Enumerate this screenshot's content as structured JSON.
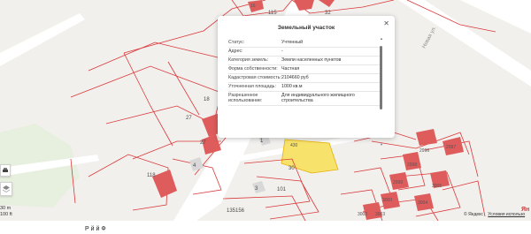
{
  "map": {
    "parcel_labels": [
      "115",
      "16",
      "32",
      "18",
      "27",
      "27",
      "4",
      "118",
      "3",
      "30",
      "101",
      "1",
      "135156",
      "430",
      "2996",
      "2997",
      "2998",
      "3005",
      "2999",
      "3004",
      "3000",
      "3003",
      "3002"
    ],
    "street_label": "Новая ул.",
    "highlight_color": "#f7e26b",
    "building_color": "#de5c5c",
    "boundary_color": "#d9383a"
  },
  "popup": {
    "title": "Земельный участок",
    "close_icon": "close-icon",
    "rows": [
      {
        "key": "Статус:",
        "value": "Учтенный"
      },
      {
        "key": "Адрес:",
        "value": "-"
      },
      {
        "key": "Категория земель:",
        "value": "Земли населенных пунктов"
      },
      {
        "key": "Форма собственности:",
        "value": "Частная"
      },
      {
        "key": "Кадастровая стоимость:",
        "value": "2104660 руб"
      },
      {
        "key": "Уточненная площадь:",
        "value": "1000 кв.м"
      },
      {
        "key": "Разрешенное использование:",
        "value": "Для индивидуального жилищного строительства"
      }
    ]
  },
  "controls": {
    "print_icon": "printer-icon",
    "layers_icon": "layers-icon"
  },
  "scale": {
    "meters": "30 m",
    "feet": "100 ft"
  },
  "attribution": {
    "logo": "Ян",
    "copyright": "© Яндекс",
    "terms": "Условия использо"
  },
  "bottom": {
    "text": "Р     й        й Ф"
  }
}
